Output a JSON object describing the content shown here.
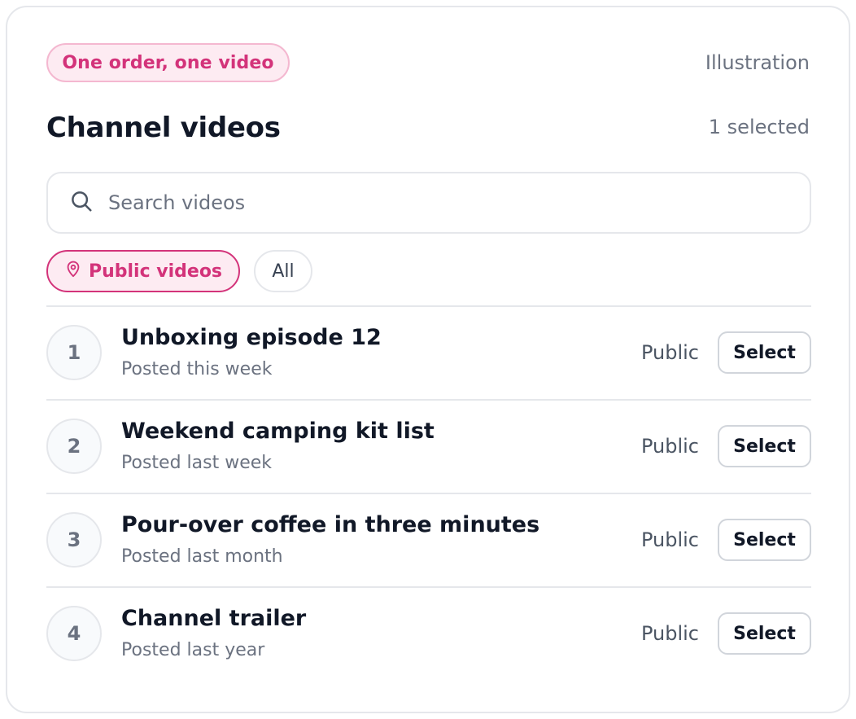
{
  "header": {
    "tag": "One order, one video",
    "illustration_label": "Illustration",
    "title": "Channel videos",
    "selected_count": "1 selected"
  },
  "search": {
    "placeholder": "Search videos",
    "value": ""
  },
  "filters": [
    {
      "label": "Public videos",
      "icon": "location-pin-icon",
      "active": true
    },
    {
      "label": "All",
      "active": false
    }
  ],
  "videos": [
    {
      "num": "1",
      "title": "Unboxing episode 12",
      "posted": "Posted this week",
      "visibility": "Public",
      "action": "Select"
    },
    {
      "num": "2",
      "title": "Weekend camping kit list",
      "posted": "Posted last week",
      "visibility": "Public",
      "action": "Select"
    },
    {
      "num": "3",
      "title": "Pour-over coffee in three minutes",
      "posted": "Posted last month",
      "visibility": "Public",
      "action": "Select"
    },
    {
      "num": "4",
      "title": "Channel trailer",
      "posted": "Posted last year",
      "visibility": "Public",
      "action": "Select"
    }
  ],
  "colors": {
    "accent": "#d3337a",
    "accent_bg": "#fdebf2",
    "border": "#e5e7eb",
    "muted_text": "#6b7280",
    "text": "#111827"
  }
}
